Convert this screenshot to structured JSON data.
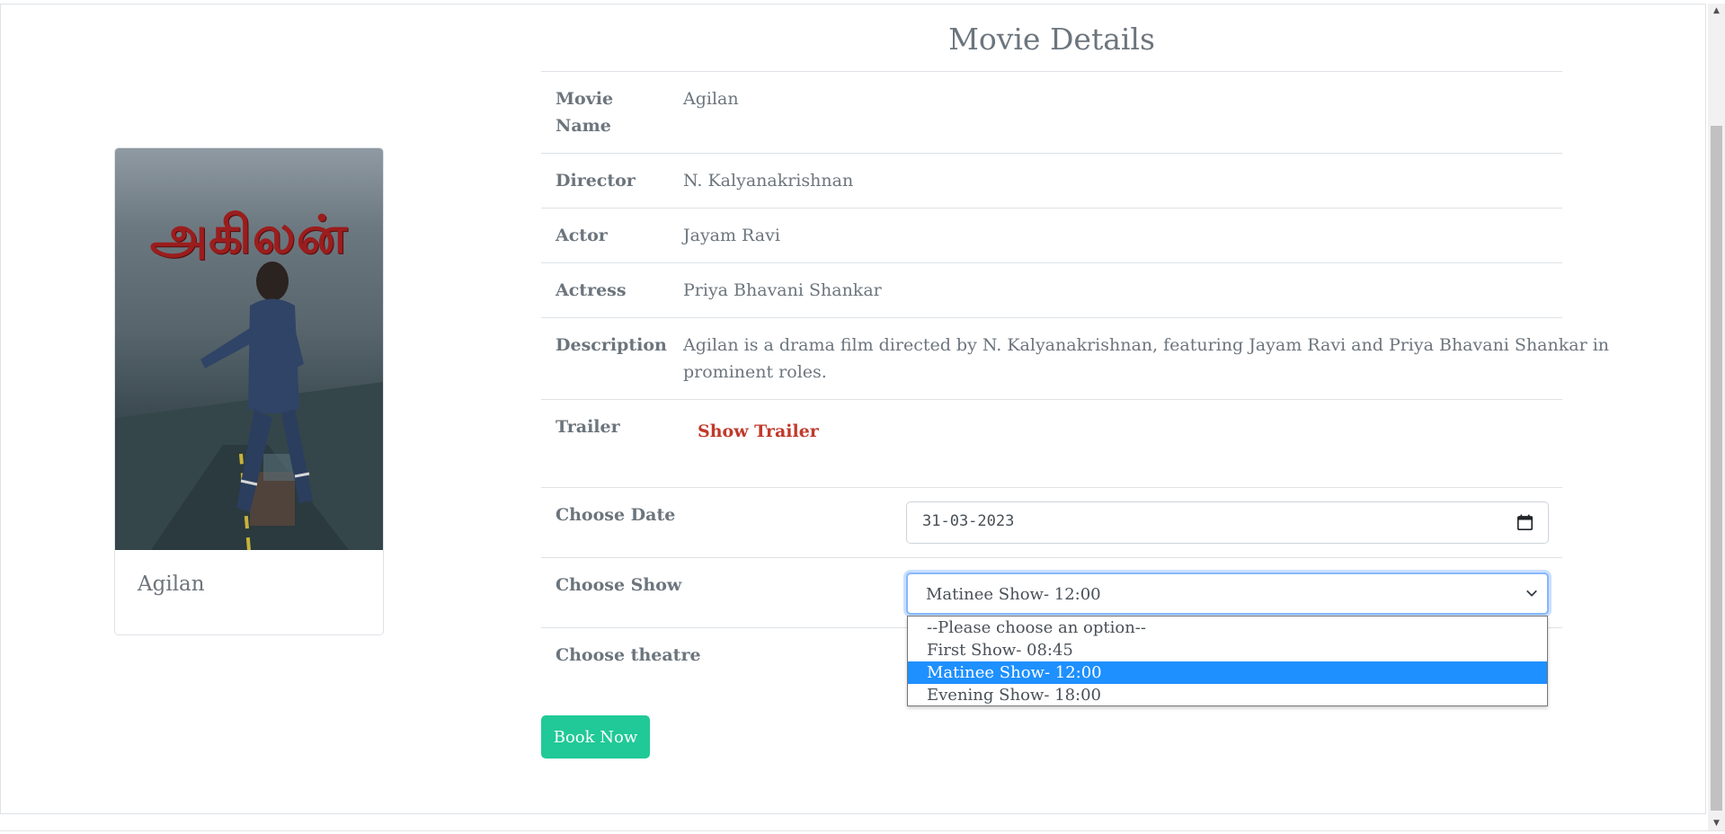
{
  "page": {
    "heading": "Movie Details"
  },
  "poster": {
    "title_text": "அகிலன்",
    "caption": "Agilan"
  },
  "details": {
    "movie_name_label_1": "Movie",
    "movie_name_label_2": "Name",
    "movie_name": "Agilan",
    "director_label": "Director",
    "director": "N. Kalyanakrishnan",
    "actor_label": "Actor",
    "actor": "Jayam Ravi",
    "actress_label": "Actress",
    "actress": "Priya Bhavani Shankar",
    "description_label": "Description",
    "description_line_1": "Agilan is a drama film directed by N. Kalyanakrishnan, featuring Jayam Ravi and Priya Bhavani Shankar in",
    "description_line_2": "prominent roles.",
    "trailer_label": "Trailer",
    "trailer_link": "Show Trailer"
  },
  "booking": {
    "date_label": "Choose Date",
    "date_value": "31-03-2023",
    "show_label": "Choose Show",
    "show_selected": "Matinee Show- 12:00",
    "show_options": [
      "--Please choose an option--",
      "First Show- 08:45",
      "Matinee Show- 12:00",
      "Evening Show- 18:00"
    ],
    "theatre_label": "Choose theatre",
    "book_button": "Book Now"
  },
  "colors": {
    "accent_green": "#20c997",
    "trailer_red": "#c0392b",
    "option_highlight": "#1e90ff",
    "text_muted": "#6c757d"
  },
  "icons": {
    "calendar": "calendar-icon",
    "chevron": "chevron-down-icon"
  }
}
